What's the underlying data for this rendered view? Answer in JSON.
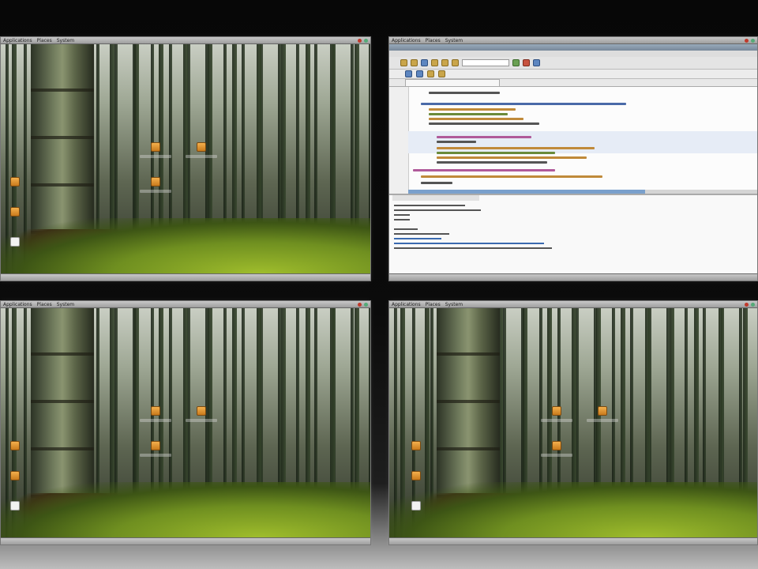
{
  "screen": {
    "description_label": "Desktop cube / workspace switcher with four virtual desktops"
  },
  "panels": {
    "menu_items": [
      "Applications",
      "Places",
      "System"
    ],
    "window_buttons": [
      "",
      ""
    ]
  },
  "ide": {
    "title": "",
    "menu_items": [
      "",
      "",
      "",
      "",
      "",
      "",
      "",
      "",
      "",
      ""
    ],
    "editor_tab": "",
    "output_tab": ""
  },
  "colors": {
    "panel": "#b4b4b4",
    "ide_bg": "#e8e8e8",
    "moss": "#8fb02a",
    "bamboo": "#6f7a5c"
  },
  "icons": [
    "folder-icon",
    "document-icon"
  ]
}
